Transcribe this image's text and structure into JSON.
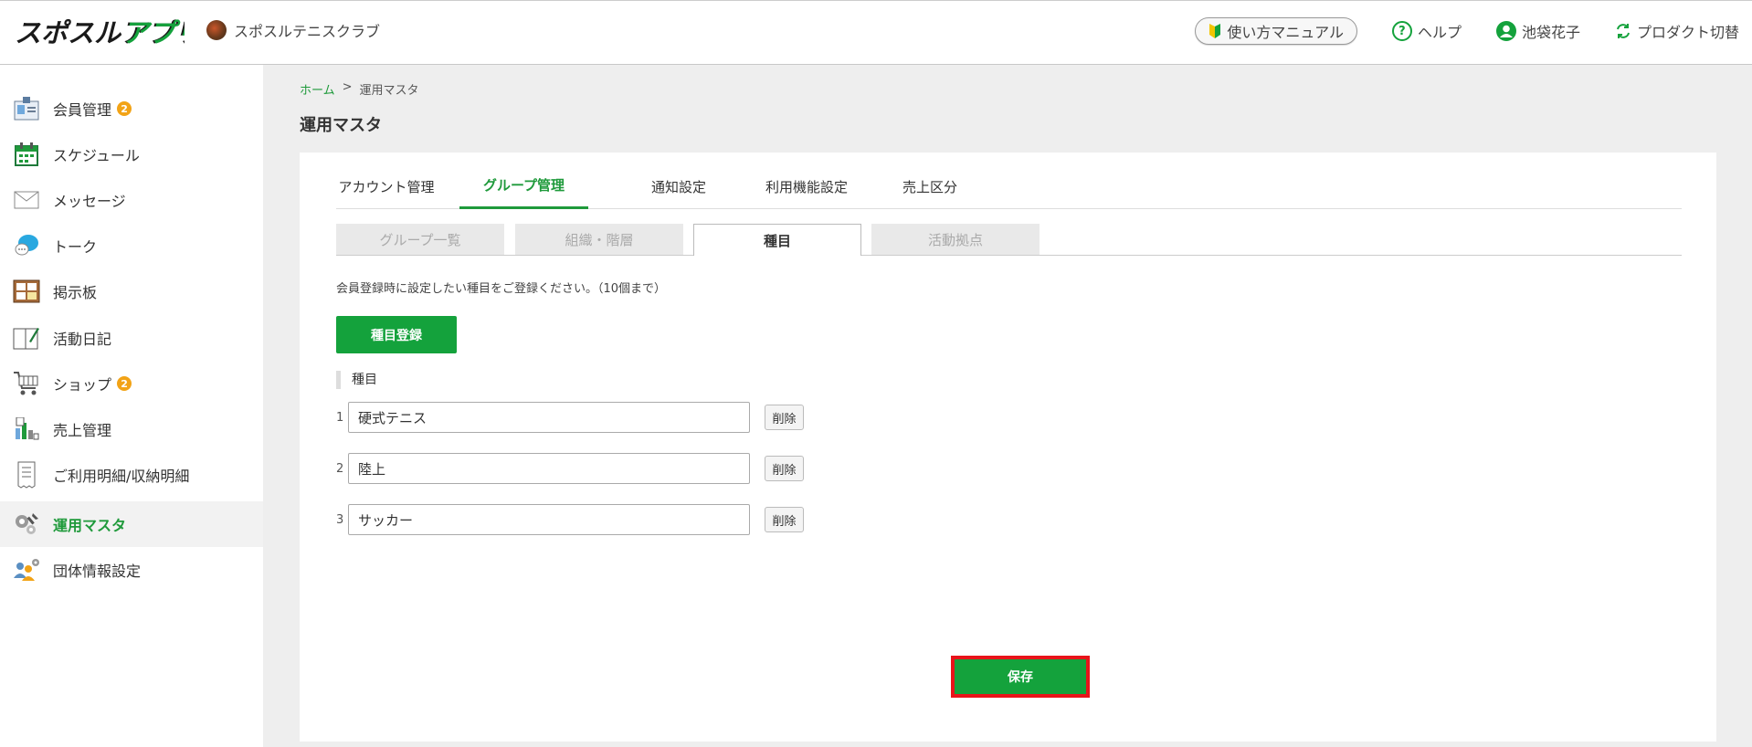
{
  "header": {
    "logo_text": "スポスルアプリ",
    "club_name": "スポスルテニスクラブ",
    "manual_label": "使い方マニュアル",
    "help_label": "ヘルプ",
    "user_name": "池袋花子",
    "product_switch_label": "プロダクト切替"
  },
  "sidebar": {
    "items": [
      {
        "label": "会員管理",
        "badge": "2",
        "icon": "member-card-icon"
      },
      {
        "label": "スケジュール",
        "icon": "calendar-icon"
      },
      {
        "label": "メッセージ",
        "icon": "envelope-icon"
      },
      {
        "label": "トーク",
        "icon": "chat-bubble-icon"
      },
      {
        "label": "掲示板",
        "icon": "bulletin-board-icon"
      },
      {
        "label": "活動日記",
        "icon": "diary-icon"
      },
      {
        "label": "ショップ",
        "badge": "2",
        "icon": "shopping-cart-icon"
      },
      {
        "label": "売上管理",
        "icon": "sales-chart-icon"
      },
      {
        "label": "ご利用明細/収納明細",
        "icon": "receipt-icon"
      },
      {
        "label": "運用マスタ",
        "icon": "gear-wrench-icon",
        "active": true
      },
      {
        "label": "団体情報設定",
        "icon": "group-settings-icon"
      }
    ]
  },
  "breadcrumb": {
    "home": "ホーム",
    "separator": ">",
    "current": "運用マスタ"
  },
  "page_title": "運用マスタ",
  "tabs": [
    {
      "label": "アカウント管理"
    },
    {
      "label": "グループ管理",
      "active": true
    },
    {
      "label": "通知設定"
    },
    {
      "label": "利用機能設定"
    },
    {
      "label": "売上区分"
    }
  ],
  "subtabs": [
    {
      "label": "グループ一覧"
    },
    {
      "label": "組織・階層"
    },
    {
      "label": "種目",
      "active": true
    },
    {
      "label": "活動拠点"
    }
  ],
  "description": "会員登録時に設定したい種目をご登録ください。（10個まで）",
  "register_button": "種目登録",
  "column_header": "種目",
  "rows": [
    {
      "num": "1",
      "value": "硬式テニス",
      "delete_label": "削除"
    },
    {
      "num": "2",
      "value": "陸上",
      "delete_label": "削除"
    },
    {
      "num": "3",
      "value": "サッカー",
      "delete_label": "削除"
    }
  ],
  "save_button": "保存",
  "colors": {
    "accent": "#14a23c",
    "highlight": "#e8141a",
    "badge": "#f2a316"
  }
}
